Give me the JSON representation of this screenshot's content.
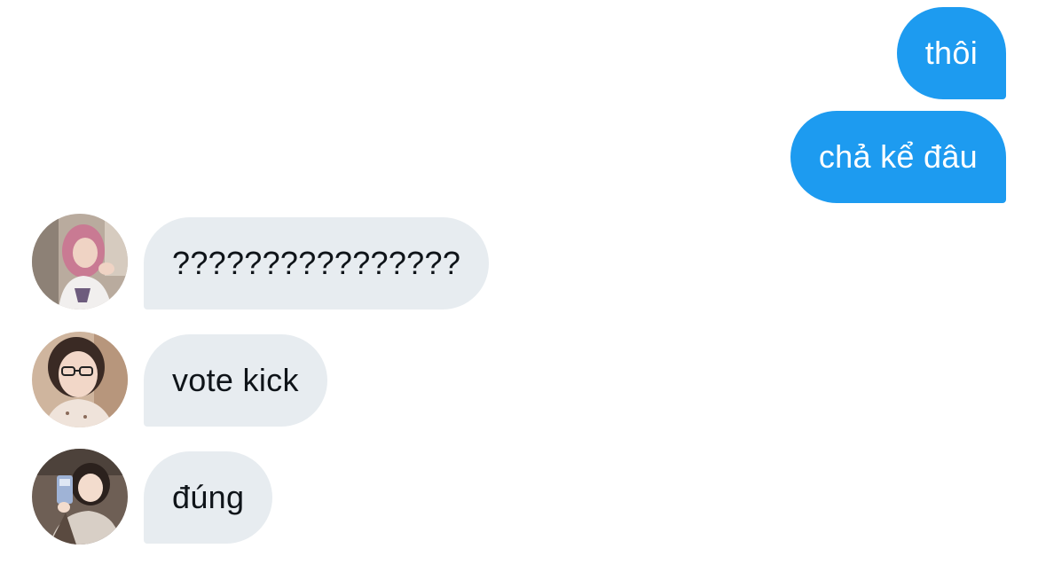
{
  "conversation": {
    "messages": [
      {
        "direction": "outgoing",
        "text": "thôi"
      },
      {
        "direction": "outgoing",
        "text": "chả kể đâu"
      },
      {
        "direction": "incoming",
        "sender_avatar": "avatar-pink-hair-icon",
        "text": "????????????????"
      },
      {
        "direction": "incoming",
        "sender_avatar": "avatar-glasses-icon",
        "text": "vote kick"
      },
      {
        "direction": "incoming",
        "sender_avatar": "avatar-mirror-selfie-icon",
        "text": "đúng"
      }
    ]
  },
  "colors": {
    "outgoing_bubble": "#1d9bf0",
    "incoming_bubble": "#e7ecf0",
    "outgoing_text": "#ffffff",
    "incoming_text": "#0f1419",
    "background": "#ffffff"
  }
}
